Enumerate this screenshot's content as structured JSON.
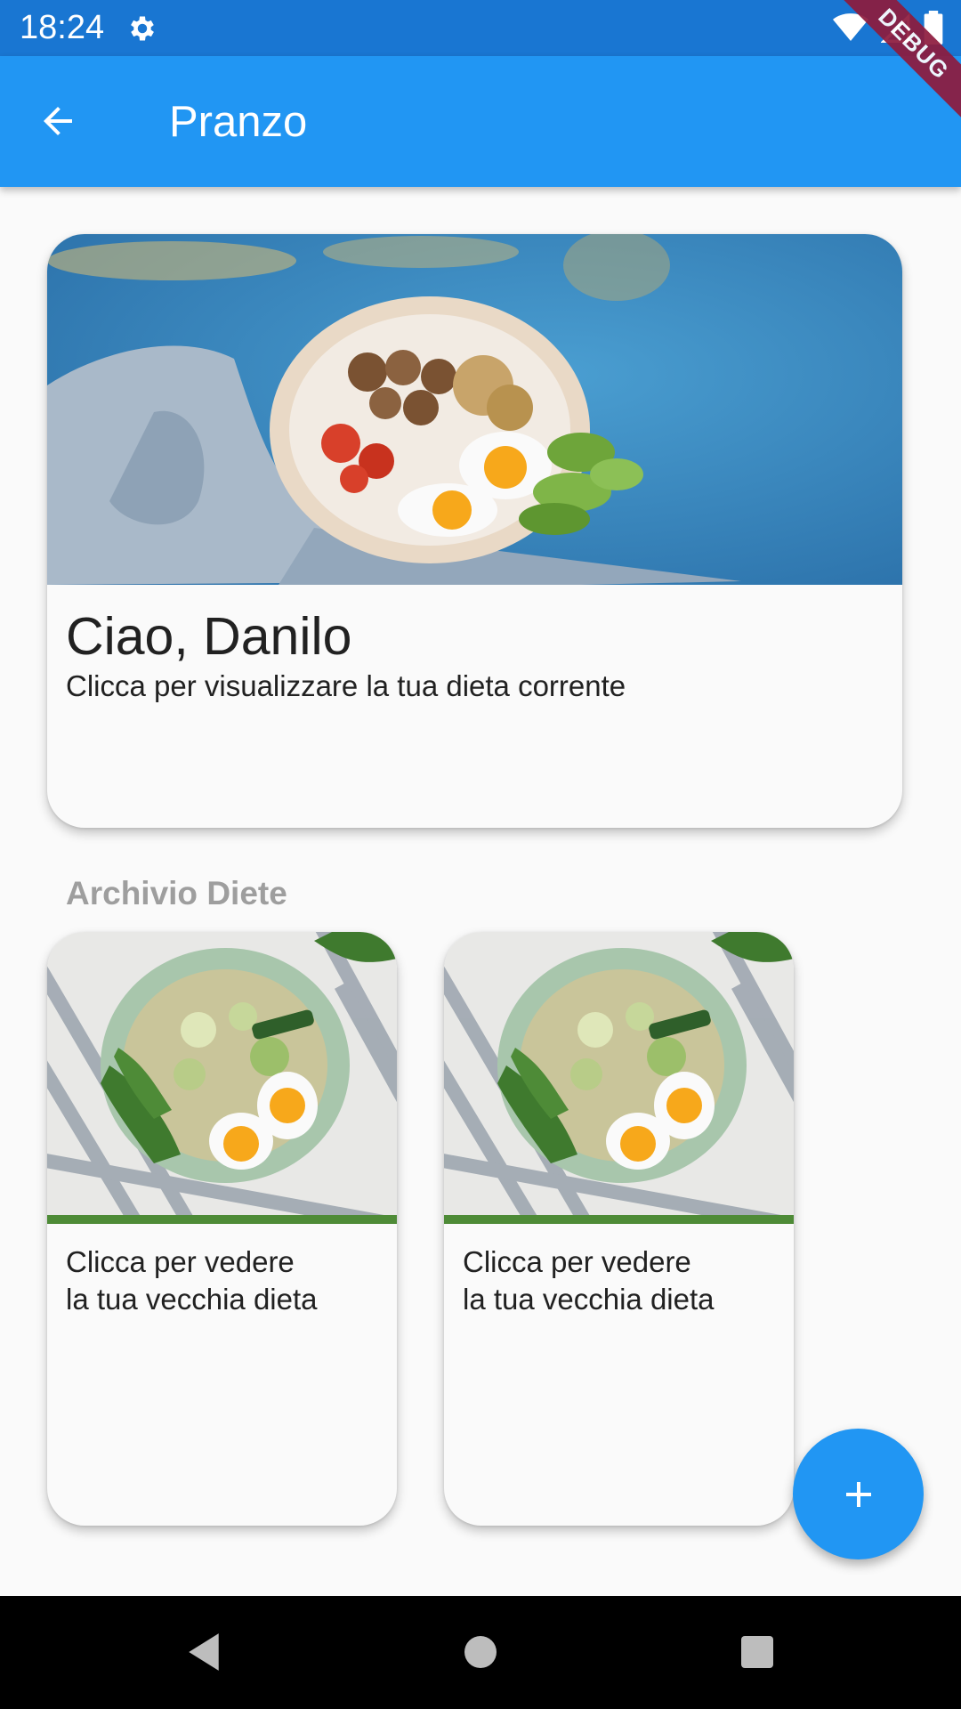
{
  "status_bar": {
    "time": "18:24",
    "debug_label": "DEBUG"
  },
  "app_bar": {
    "title": "Pranzo"
  },
  "main_card": {
    "title": "Ciao, Danilo",
    "subtitle": "Clicca per visualizzare la tua dieta corrente",
    "image": "bowl-with-eggs-mushrooms-tomatoes-cucumber-photo"
  },
  "archive": {
    "section_title": "Archivio Diete",
    "cards": [
      {
        "line1": "Clicca per vedere",
        "line2": "la tua vecchia dieta",
        "image": "rice-eggs-vegetables-plate-photo"
      },
      {
        "line1": "Clicca per vedere",
        "line2": "la tua vecchia dieta",
        "image": "rice-eggs-vegetables-plate-photo"
      }
    ]
  },
  "icons": {
    "back": "arrow-back-icon",
    "settings": "gear-icon",
    "wifi": "wifi-icon",
    "signal": "signal-icon",
    "battery": "battery-icon",
    "fab": "plus-icon",
    "nav_back": "triangle-back-icon",
    "nav_home": "circle-home-icon",
    "nav_recent": "square-recent-icon"
  },
  "colors": {
    "status_bar": "#1976d2",
    "app_bar": "#2196f3",
    "fab": "#2196f3",
    "section_title": "#9e9e9e",
    "debug_ribbon": "#8e1b3d"
  }
}
